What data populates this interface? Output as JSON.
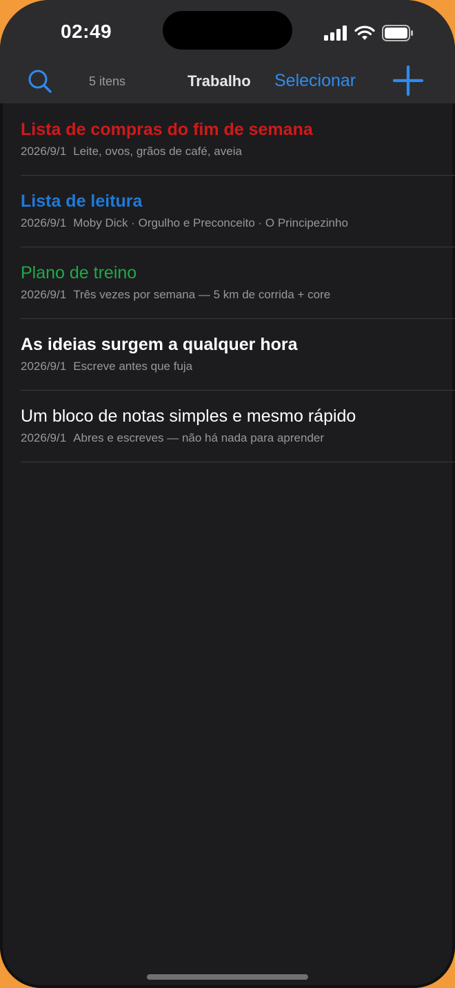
{
  "status_bar": {
    "time": "02:49"
  },
  "navbar": {
    "count_label": "5 itens",
    "title": "Trabalho",
    "select_label": "Selecionar"
  },
  "icons": {
    "search": "search-icon",
    "add": "plus-icon",
    "signal": "cellular-signal-icon",
    "wifi": "wifi-icon",
    "battery": "battery-icon"
  },
  "colors": {
    "accent": "#2f8bf0",
    "red": "#d21919",
    "blue": "#1f7ad8",
    "green": "#22a84a",
    "white": "#ffffff"
  },
  "notes": [
    {
      "title": "Lista de compras do fim de semana",
      "date": "2026/9/1",
      "preview": "Leite, ovos, grãos de café, aveia",
      "color": "#d21919",
      "bold": true
    },
    {
      "title": "Lista de leitura",
      "date": "2026/9/1",
      "preview": "Moby Dick · Orgulho e Preconceito · O Principezinho",
      "color": "#1f7ad8",
      "bold": true
    },
    {
      "title": "Plano de treino",
      "date": "2026/9/1",
      "preview": "Três vezes por semana — 5 km de corrida + core",
      "color": "#22a84a",
      "bold": false
    },
    {
      "title": "As ideias surgem a qualquer hora",
      "date": "2026/9/1",
      "preview": "Escreve antes que fuja",
      "color": "#ffffff",
      "bold": true
    },
    {
      "title": "Um bloco de notas simples e mesmo rápido",
      "date": "2026/9/1",
      "preview": "Abres e escreves — não há nada para aprender",
      "color": "#ffffff",
      "bold": false
    }
  ]
}
